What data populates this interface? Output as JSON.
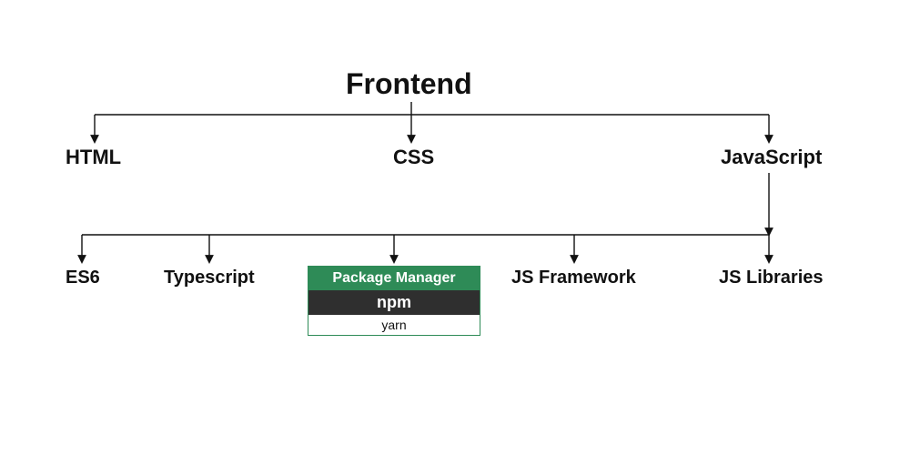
{
  "diagram": {
    "title": "Frontend",
    "level2": {
      "html": "HTML",
      "css": "CSS",
      "js": "JavaScript"
    },
    "level3": {
      "es6": "ES6",
      "typescript": "Typescript",
      "pkg_header": "Package Manager",
      "pkg_item1": "npm",
      "pkg_item2": "yarn",
      "js_framework": "JS Framework",
      "js_libraries": "JS Libraries"
    }
  }
}
